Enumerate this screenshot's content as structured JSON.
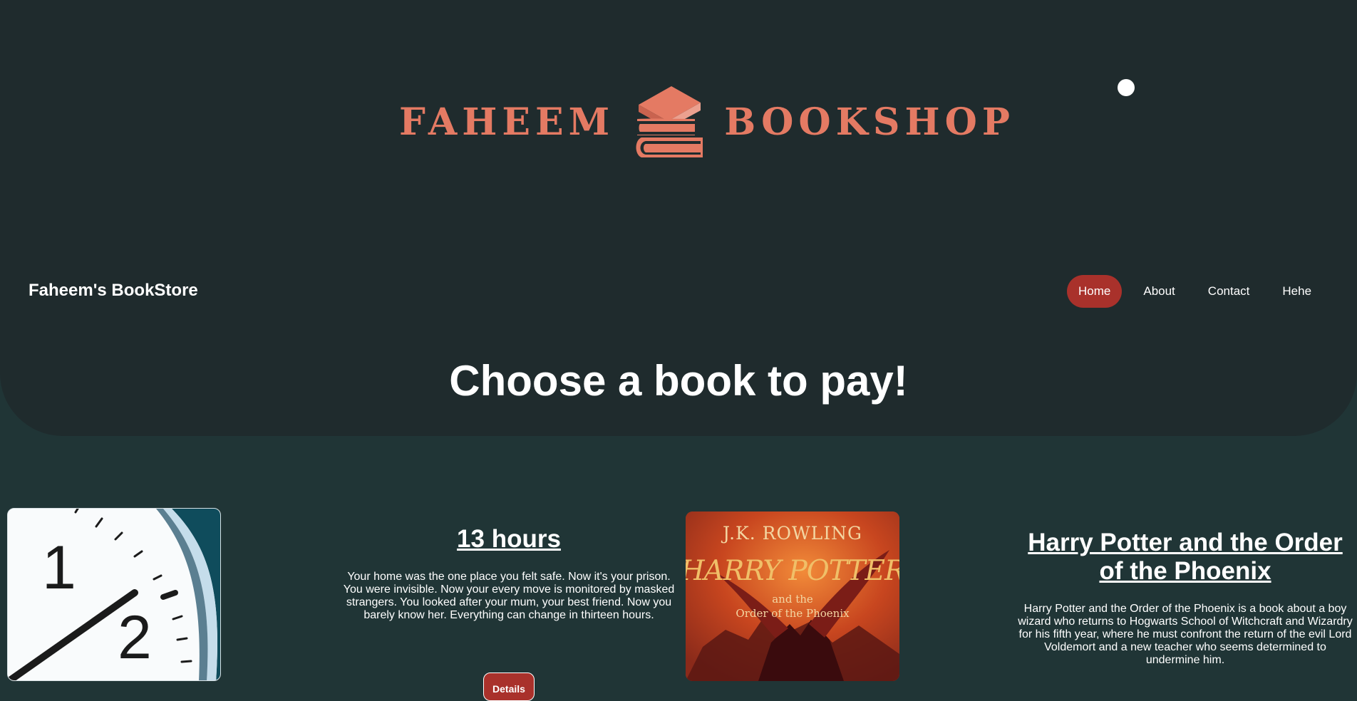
{
  "logo": {
    "left_word": "FAHEEM",
    "right_word": "BOOKSHOP",
    "icon": "stacked-books-icon",
    "color": "#e47a63"
  },
  "header": {
    "site_name": "Faheem's BookStore",
    "nav": [
      {
        "label": "Home",
        "active": true
      },
      {
        "label": "About",
        "active": false
      },
      {
        "label": "Contact",
        "active": false
      },
      {
        "label": "Hehe",
        "active": false
      }
    ],
    "active_color": "#a9312b"
  },
  "main": {
    "title": "Choose a book to pay!",
    "books": [
      {
        "title": "13 hours",
        "description": "Your home was the one place you felt safe. Now it's your prison. You were invisible. Now your every move is monitored by masked strangers. You looked after your mum, your best friend. Now you barely know her. Everything can change in thirteen hours.",
        "button_label": "Details",
        "image": {
          "clock_numbers": [
            "1",
            "2"
          ]
        }
      },
      {
        "title": "Harry Potter and the Order of the Phoenix",
        "description": "Harry Potter and the Order of the Phoenix is a book about a boy wizard who returns to Hogwarts School of Witchcraft and Wizardry for his fifth year, where he must confront the return of the evil Lord Voldemort and a new teacher who seems determined to undermine him.",
        "image": {
          "author": "J.K. ROWLING",
          "series": "HARRY POTTER",
          "subtitle_line_1": "and the",
          "subtitle_line_2": "Order of the Phoenix"
        }
      }
    ]
  },
  "colors": {
    "page_background": "#203536",
    "hero_background": "#1f2b2d",
    "text": "#ffffff"
  }
}
